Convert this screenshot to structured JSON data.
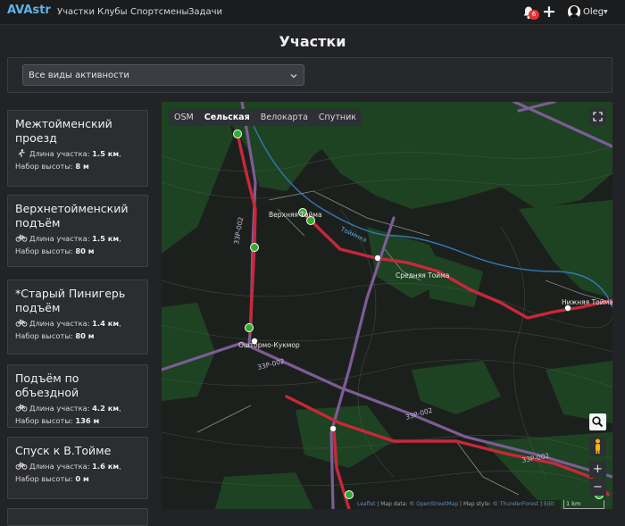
{
  "navbar": {
    "brand": "AVAstr",
    "links": [
      "Участки",
      "Клубы",
      "Спортсмены",
      "Задачи"
    ],
    "notification_count": "6",
    "username": "Oleg"
  },
  "page": {
    "title": "Участки"
  },
  "filter": {
    "activity_select": "Все виды активности"
  },
  "segments": [
    {
      "title": "Межтойменский проезд",
      "activity_icon": "runner-icon",
      "length_label": "Длина участка:",
      "length": "1.5 км",
      "climb_label": "Набор высоты:",
      "climb": "8 м"
    },
    {
      "title": "Верхнетойменский подъём",
      "activity_icon": "bicycle-icon",
      "length_label": "Длина участка:",
      "length": "1.5 км",
      "climb_label": "Набор высоты:",
      "climb": "80 м"
    },
    {
      "title": "*Старый Пинигерь подъём",
      "activity_icon": "bicycle-icon",
      "length_label": "Длина участка:",
      "length": "1.4 км",
      "climb_label": "Набор высоты:",
      "climb": "80 м"
    },
    {
      "title": "Подъём по объездной",
      "activity_icon": "bicycle-icon",
      "length_label": "Длина участка:",
      "length": "4.2 км",
      "climb_label": "Набор высоты:",
      "climb": "136 м"
    },
    {
      "title": "Спуск к В.Тойме",
      "activity_icon": "bicycle-icon",
      "length_label": "Длина участка:",
      "length": "1.6 км",
      "climb_label": "Набор высоты:",
      "climb": "0 м"
    }
  ],
  "map": {
    "layers": [
      "OSM",
      "Сельская",
      "Велокарта",
      "Спутник"
    ],
    "active_layer": "Сельская",
    "places": [
      "Верхняя Тойма",
      "Средняя Тойма",
      "Нижняя Тойма",
      "Оштормо-Кукмор"
    ],
    "river": "Тоймнка",
    "road_ref": "33Р-002",
    "attribution": {
      "leaflet": "Leaflet",
      "map_data": "Map data: ©",
      "osm": "OpenStreetMap",
      "map_style": "Map style: ©",
      "tf": "ThunderForest",
      "edit": "Edit"
    },
    "scale": "1 km",
    "colors": {
      "route": "#c8283a",
      "road": "#7d5c96",
      "pin": "#2fae2f",
      "forest": "#1f4a23"
    }
  }
}
